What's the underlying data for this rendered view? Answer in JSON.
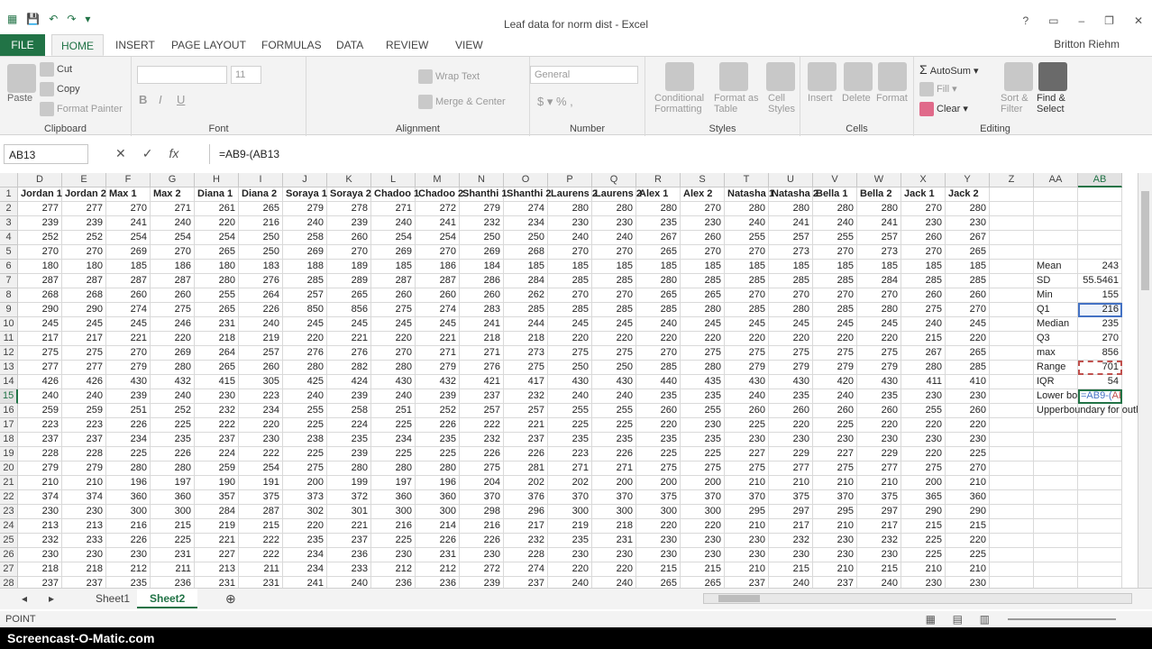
{
  "window": {
    "title": "Leaf data for norm dist - Excel",
    "user": "Britton Riehm"
  },
  "menu_tabs": [
    "FILE",
    "HOME",
    "INSERT",
    "PAGE LAYOUT",
    "FORMULAS",
    "DATA",
    "REVIEW",
    "VIEW"
  ],
  "ribbon": {
    "clipboard": {
      "paste": "Paste",
      "cut": "Cut",
      "copy": "Copy",
      "format_painter": "Format Painter",
      "label": "Clipboard"
    },
    "font": {
      "size": "11",
      "label": "Font"
    },
    "alignment": {
      "wrap": "Wrap Text",
      "merge": "Merge & Center",
      "label": "Alignment"
    },
    "number": {
      "format": "General",
      "label": "Number"
    },
    "styles": {
      "cond_a": "Conditional",
      "cond_b": "Formatting",
      "fmt_a": "Format as",
      "fmt_b": "Table",
      "cell_a": "Cell",
      "cell_b": "Styles",
      "label": "Styles"
    },
    "cells": {
      "insert": "Insert",
      "delete": "Delete",
      "format": "Format",
      "label": "Cells"
    },
    "editing": {
      "autosum": "AutoSum",
      "fill": "Fill",
      "clear": "Clear",
      "sort_a": "Sort &",
      "sort_b": "Filter",
      "find_a": "Find &",
      "find_b": "Select",
      "label": "Editing"
    }
  },
  "formula_bar": {
    "name_box": "AB13",
    "formula": "=AB9-(AB13"
  },
  "columns": [
    "D",
    "E",
    "F",
    "G",
    "H",
    "I",
    "J",
    "K",
    "L",
    "M",
    "N",
    "O",
    "P",
    "Q",
    "R",
    "S",
    "T",
    "U",
    "V",
    "W",
    "X",
    "Y",
    "Z",
    "AA",
    "AB"
  ],
  "headers": [
    "Jordan 1",
    "Jordan 2",
    "Max 1",
    "Max 2",
    "Diana 1",
    "Diana 2",
    "Soraya 1",
    "Soraya 2",
    "Chadoo 1",
    "Chadoo 2",
    "Shanthi 1",
    "Shanthi 2",
    "Laurens 2",
    "Laurens 2",
    "Alex 1",
    "Alex 2",
    "Natasha 1",
    "Natasha 2",
    "Bella 1",
    "Bella 2",
    "Jack 1",
    "Jack 2"
  ],
  "rows": [
    [
      277,
      277,
      270,
      271,
      261,
      265,
      279,
      278,
      271,
      272,
      279,
      274,
      280,
      280,
      280,
      270,
      280,
      280,
      280,
      280,
      270,
      280
    ],
    [
      239,
      239,
      241,
      240,
      220,
      216,
      240,
      239,
      240,
      241,
      232,
      234,
      230,
      230,
      235,
      230,
      240,
      241,
      240,
      241,
      230,
      230
    ],
    [
      252,
      252,
      254,
      254,
      254,
      250,
      258,
      260,
      254,
      254,
      250,
      250,
      240,
      240,
      267,
      260,
      255,
      257,
      255,
      257,
      260,
      267
    ],
    [
      270,
      270,
      269,
      270,
      265,
      250,
      269,
      270,
      269,
      270,
      269,
      268,
      270,
      270,
      265,
      270,
      270,
      273,
      270,
      273,
      270,
      265
    ],
    [
      180,
      180,
      185,
      186,
      180,
      183,
      188,
      189,
      185,
      186,
      184,
      185,
      185,
      185,
      185,
      185,
      185,
      185,
      185,
      185,
      185,
      185
    ],
    [
      287,
      287,
      287,
      287,
      280,
      276,
      285,
      289,
      287,
      287,
      286,
      284,
      285,
      285,
      280,
      285,
      285,
      285,
      285,
      284,
      285,
      285
    ],
    [
      268,
      268,
      260,
      260,
      255,
      264,
      257,
      265,
      260,
      260,
      260,
      262,
      270,
      270,
      265,
      265,
      270,
      270,
      270,
      270,
      260,
      260
    ],
    [
      290,
      290,
      274,
      275,
      265,
      226,
      850,
      856,
      275,
      274,
      283,
      285,
      285,
      285,
      285,
      280,
      285,
      280,
      285,
      280,
      275,
      270
    ],
    [
      245,
      245,
      245,
      246,
      231,
      240,
      245,
      245,
      245,
      245,
      241,
      244,
      245,
      245,
      240,
      245,
      245,
      245,
      245,
      245,
      240,
      245
    ],
    [
      217,
      217,
      221,
      220,
      218,
      219,
      220,
      221,
      220,
      221,
      218,
      218,
      220,
      220,
      220,
      220,
      220,
      220,
      220,
      220,
      215,
      220
    ],
    [
      275,
      275,
      270,
      269,
      264,
      257,
      276,
      276,
      270,
      271,
      271,
      273,
      275,
      275,
      270,
      275,
      275,
      275,
      275,
      275,
      267,
      265
    ],
    [
      277,
      277,
      279,
      280,
      265,
      260,
      280,
      282,
      280,
      279,
      276,
      275,
      250,
      250,
      285,
      280,
      279,
      279,
      279,
      279,
      280,
      285
    ],
    [
      426,
      426,
      430,
      432,
      415,
      305,
      425,
      424,
      430,
      432,
      421,
      417,
      430,
      430,
      440,
      435,
      430,
      430,
      420,
      430,
      411,
      410
    ],
    [
      240,
      240,
      239,
      240,
      230,
      223,
      240,
      239,
      240,
      239,
      237,
      232,
      240,
      240,
      235,
      235,
      240,
      235,
      240,
      235,
      230,
      230
    ],
    [
      259,
      259,
      251,
      252,
      232,
      234,
      255,
      258,
      251,
      252,
      257,
      257,
      255,
      255,
      260,
      255,
      260,
      260,
      260,
      260,
      255,
      260
    ],
    [
      223,
      223,
      226,
      225,
      222,
      220,
      225,
      224,
      225,
      226,
      222,
      221,
      225,
      225,
      220,
      230,
      225,
      220,
      225,
      220,
      220,
      220
    ],
    [
      237,
      237,
      234,
      235,
      237,
      230,
      238,
      235,
      234,
      235,
      232,
      237,
      235,
      235,
      235,
      235,
      230,
      230,
      230,
      230,
      230,
      230
    ],
    [
      228,
      228,
      225,
      226,
      224,
      222,
      225,
      239,
      225,
      225,
      226,
      226,
      223,
      226,
      225,
      225,
      227,
      229,
      227,
      229,
      220,
      225
    ],
    [
      279,
      279,
      280,
      280,
      259,
      254,
      275,
      280,
      280,
      280,
      275,
      281,
      271,
      271,
      275,
      275,
      275,
      277,
      275,
      277,
      275,
      270
    ],
    [
      210,
      210,
      196,
      197,
      190,
      191,
      200,
      199,
      197,
      196,
      204,
      202,
      202,
      200,
      200,
      200,
      210,
      210,
      210,
      210,
      200,
      210
    ],
    [
      374,
      374,
      360,
      360,
      357,
      375,
      373,
      372,
      360,
      360,
      370,
      376,
      370,
      370,
      375,
      370,
      370,
      375,
      370,
      375,
      365,
      360
    ],
    [
      230,
      230,
      300,
      300,
      284,
      287,
      302,
      301,
      300,
      300,
      298,
      296,
      300,
      300,
      300,
      300,
      295,
      297,
      295,
      297,
      290,
      290
    ],
    [
      213,
      213,
      216,
      215,
      219,
      215,
      220,
      221,
      216,
      214,
      216,
      217,
      219,
      218,
      220,
      220,
      210,
      217,
      210,
      217,
      215,
      215
    ],
    [
      232,
      233,
      226,
      225,
      221,
      222,
      235,
      237,
      225,
      226,
      226,
      232,
      235,
      231,
      230,
      230,
      230,
      232,
      230,
      232,
      225,
      220
    ],
    [
      230,
      230,
      230,
      231,
      227,
      222,
      234,
      236,
      230,
      231,
      230,
      228,
      230,
      230,
      230,
      230,
      230,
      230,
      230,
      230,
      225,
      225
    ],
    [
      218,
      218,
      212,
      211,
      213,
      211,
      234,
      233,
      212,
      212,
      272,
      274,
      220,
      220,
      215,
      215,
      210,
      215,
      210,
      215,
      210,
      210
    ],
    [
      237,
      237,
      235,
      236,
      231,
      231,
      241,
      240,
      236,
      236,
      239,
      237,
      240,
      240,
      265,
      265,
      237,
      240,
      237,
      240,
      230,
      230
    ]
  ],
  "stats": [
    {
      "row": 6,
      "label": "Mean",
      "value": "243"
    },
    {
      "row": 7,
      "label": "SD",
      "value": "55.5461"
    },
    {
      "row": 8,
      "label": "Min",
      "value": "155"
    },
    {
      "row": 9,
      "label": "Q1",
      "value": "216"
    },
    {
      "row": 10,
      "label": "Median",
      "value": "235"
    },
    {
      "row": 11,
      "label": "Q3",
      "value": "270"
    },
    {
      "row": 12,
      "label": "max",
      "value": "856"
    },
    {
      "row": 13,
      "label": "Range",
      "value": "701"
    },
    {
      "row": 14,
      "label": "IQR",
      "value": "54"
    },
    {
      "row": 15,
      "label": "Lower bo",
      "value": "=AB9-(AB13"
    },
    {
      "row": 16,
      "label": "Upperboundary for outliers",
      "value": ""
    }
  ],
  "sheets": [
    "Sheet1",
    "Sheet2"
  ],
  "status": {
    "mode": "POINT"
  },
  "watermark": "Screencast-O-Matic.com"
}
